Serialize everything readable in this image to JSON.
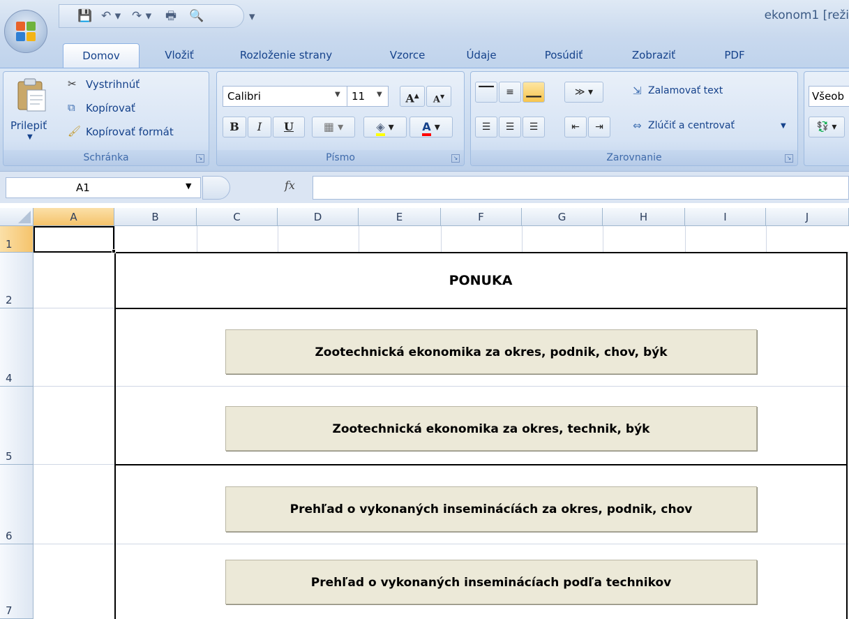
{
  "window": {
    "title": "ekonom1  [reži"
  },
  "qat": {
    "save": "💾",
    "undo": "↶ ▾",
    "redo": "↷ ▾",
    "print": "🖶",
    "preview": "🔍",
    "customize": "▾"
  },
  "tabs": [
    "Domov",
    "Vložiť",
    "Rozloženie strany",
    "Vzorce",
    "Údaje",
    "Posúdiť",
    "Zobraziť",
    "PDF"
  ],
  "ribbon": {
    "clipboard": {
      "label": "Schránka",
      "paste": "Prilepiť",
      "cut": "Vystrihnúť",
      "copy": "Kopírovať",
      "format_painter": "Kopírovať formát"
    },
    "font": {
      "label": "Písmo",
      "font_name": "Calibri",
      "font_size": "11",
      "bold": "B",
      "italic": "I",
      "underline": "U"
    },
    "alignment": {
      "label": "Zarovnanie",
      "wrap_text": "Zalamovať text",
      "merge_center": "Zlúčiť a centrovať"
    },
    "number": {
      "format": "Všeob"
    }
  },
  "formula_bar": {
    "name_box": "A1",
    "fx": "fx",
    "value": ""
  },
  "columns": [
    "A",
    "B",
    "C",
    "D",
    "E",
    "F",
    "G",
    "H",
    "I",
    "J"
  ],
  "rows": [
    "1",
    "2",
    "4",
    "5",
    "6",
    "7"
  ],
  "sheet": {
    "title": "PONUKA",
    "buttons": [
      "Zootechnická ekonomika za okres, podnik, chov, býk",
      "Zootechnická ekonomika za okres, technik, býk",
      "Prehľad o vykonaných inseminácíách za okres, podnik, chov",
      "Prehľad o vykonaných inseminácíach podľa technikov"
    ]
  },
  "colors": {
    "accent": "#15428b",
    "selection": "#f5c36b",
    "button_face": "#ece9d8"
  }
}
